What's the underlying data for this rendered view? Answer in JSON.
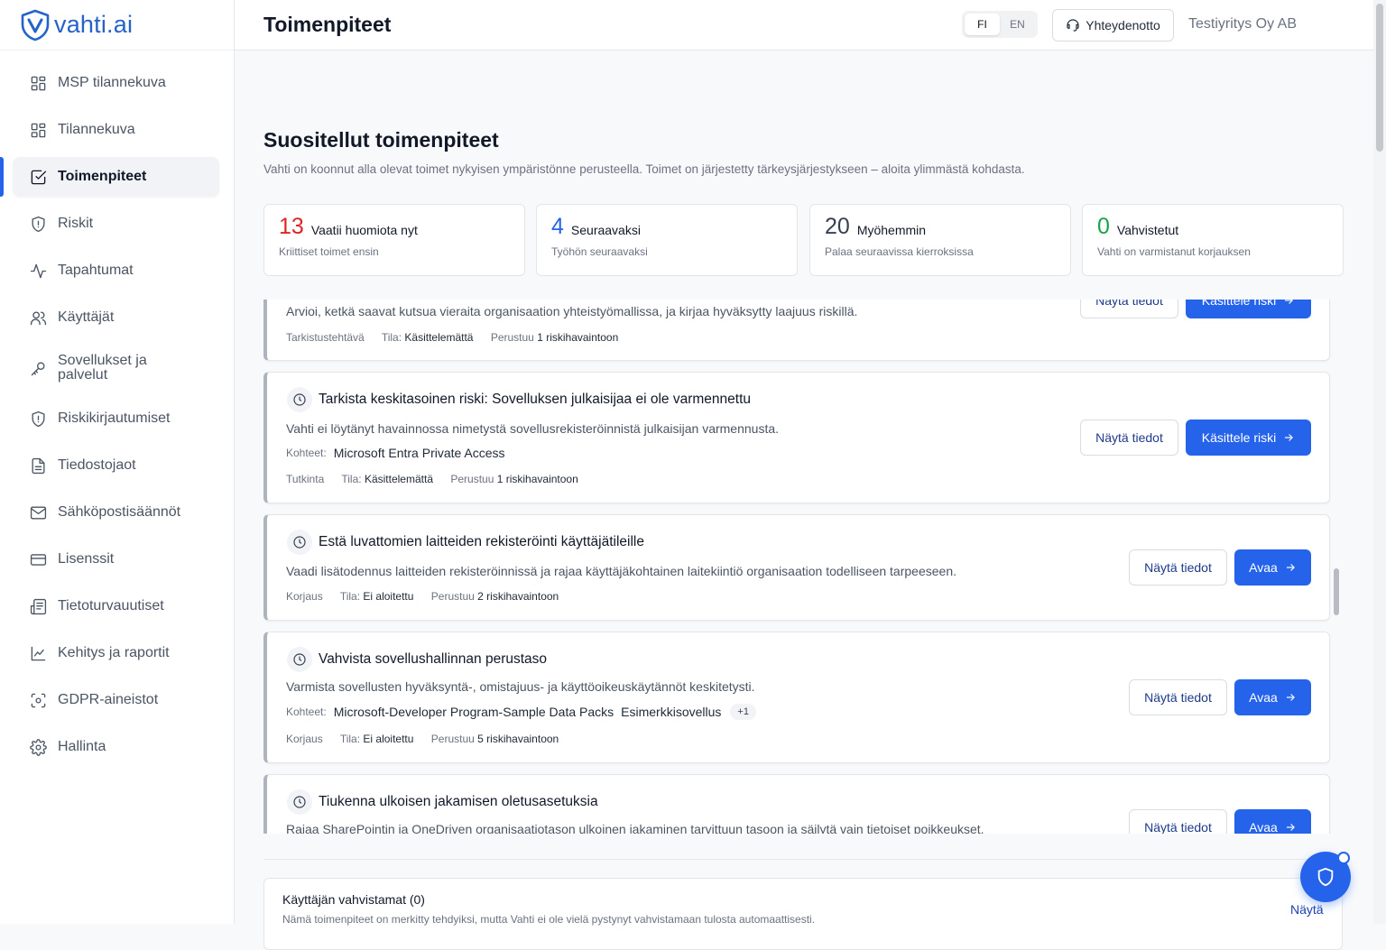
{
  "app": {
    "logo_text": "vahti.ai"
  },
  "sidebar": {
    "items": [
      {
        "label": "MSP tilannekuva",
        "icon": "grid-icon"
      },
      {
        "label": "Tilannekuva",
        "icon": "grid-icon"
      },
      {
        "label": "Toimenpiteet",
        "icon": "check-square-icon",
        "active": true
      },
      {
        "label": "Riskit",
        "icon": "shield-icon"
      },
      {
        "label": "Tapahtumat",
        "icon": "activity-icon"
      },
      {
        "label": "Käyttäjät",
        "icon": "users-icon"
      },
      {
        "label": "Sovellukset ja palvelut",
        "icon": "key-icon"
      },
      {
        "label": "Riskikirjautumiset",
        "icon": "shield-icon"
      },
      {
        "label": "Tiedostojaot",
        "icon": "file-icon"
      },
      {
        "label": "Sähköpostisäännöt",
        "icon": "mail-icon"
      },
      {
        "label": "Lisenssit",
        "icon": "card-icon"
      },
      {
        "label": "Tietoturvauutiset",
        "icon": "news-icon"
      },
      {
        "label": "Kehitys ja raportit",
        "icon": "chart-icon"
      },
      {
        "label": "GDPR-aineistot",
        "icon": "scan-icon"
      },
      {
        "label": "Hallinta",
        "icon": "gear-icon"
      }
    ]
  },
  "header": {
    "title": "Toimenpiteet",
    "lang_fi": "FI",
    "lang_en": "EN",
    "active_lang": "FI",
    "contact": "Yhteydenotto",
    "company": "Testiyritys Oy AB"
  },
  "section": {
    "title": "Suositellut toimenpiteet",
    "description": "Vahti on koonnut alla olevat toimet nykyisen ympäristönne perusteella. Toimet on järjestetty tärkeysjärjestykseen – aloita ylimmästä kohdasta."
  },
  "stats": [
    {
      "value": "13",
      "label": "Vaatii huomiota nyt",
      "sub": "Kriittiset toimet ensin",
      "color": "#dc2626"
    },
    {
      "value": "4",
      "label": "Seuraavaksi",
      "sub": "Työhön seuraavaksi",
      "color": "#2563eb"
    },
    {
      "value": "20",
      "label": "Myöhemmin",
      "sub": "Palaa seuraavissa kierroksissa",
      "color": "#374151"
    },
    {
      "value": "0",
      "label": "Vahvistetut",
      "sub": "Vahti on varmistanut korjauksen",
      "color": "#16a34a"
    }
  ],
  "labels": {
    "targets": "Kohteet:",
    "status": "Tila:",
    "based_on": "Perustuu",
    "details": "Näytä tiedot"
  },
  "cards": [
    {
      "title": "",
      "description": "Arvioi, ketkä saavat kutsua vieraita organisaation yhteistyömallissa, ja kirjaa hyväksytty laajuus riskillä.",
      "type": "Tarkistustehtävä",
      "status": "Käsittelemättä",
      "based_on": "1 riskihavaintoon",
      "action": "Käsittele riski"
    },
    {
      "title": "Tarkista keskitasoinen riski: Sovelluksen julkaisijaa ei ole varmennettu",
      "description": "Vahti ei löytänyt havainnossa nimetystä sovellusrekisteröinnistä julkaisijan varmennusta.",
      "targets": [
        "Microsoft Entra Private Access"
      ],
      "type": "Tutkinta",
      "status": "Käsittelemättä",
      "based_on": "1 riskihavaintoon",
      "action": "Käsittele riski"
    },
    {
      "title": "Estä luvattomien laitteiden rekisteröinti käyttäjätileille",
      "description": "Vaadi lisätodennus laitteiden rekisteröinnissä ja rajaa käyttäjäkohtainen laitekiintiö organisaation todelliseen tarpeeseen.",
      "type": "Korjaus",
      "status": "Ei aloitettu",
      "based_on": "2 riskihavaintoon",
      "action": "Avaa"
    },
    {
      "title": "Vahvista sovellushallinnan perustaso",
      "description": "Varmista sovellusten hyväksyntä-, omistajuus- ja käyttöoikeuskäytännöt keskitetysti.",
      "targets": [
        "Microsoft-Developer Program-Sample Data Packs",
        "Esimerkkisovellus"
      ],
      "targets_more": "+1",
      "type": "Korjaus",
      "status": "Ei aloitettu",
      "based_on": "5 riskihavaintoon",
      "action": "Avaa"
    },
    {
      "title": "Tiukenna ulkoisen jakamisen oletusasetuksia",
      "description": "Rajaa SharePointin ja OneDriven organisaatiotason ulkoinen jakaminen tarvittuun tasoon ja säilytä vain tietoiset poikkeukset.",
      "action": "Avaa"
    }
  ],
  "confirmed": {
    "title": "Käyttäjän vahvistamat (0)",
    "subtitle": "Nämä toimenpiteet on merkitty tehdyiksi, mutta Vahti ei ole vielä pystynyt vahvistamaan tulosta automaattisesti.",
    "show": "Näytä"
  }
}
